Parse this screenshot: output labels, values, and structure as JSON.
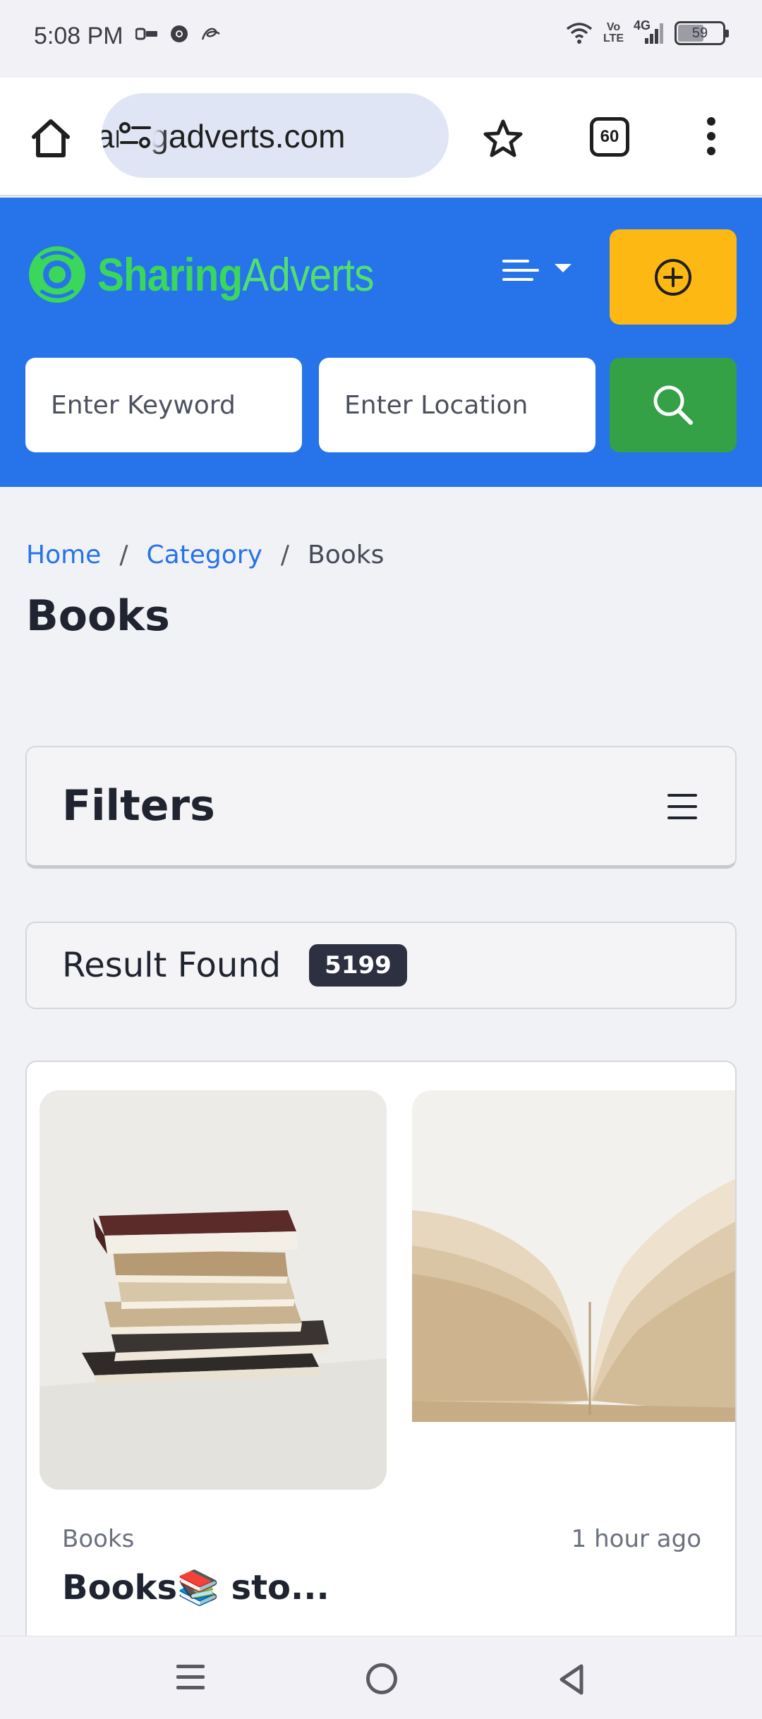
{
  "status_bar": {
    "time": "5:08 PM",
    "network_top": "Vo",
    "network_bottom": "LTE",
    "signal_label": "4G",
    "battery": "59",
    "icons": [
      "outlook-icon",
      "chrome-icon",
      "ink-icon",
      "wifi-icon",
      "signal-icon",
      "battery-icon"
    ]
  },
  "browser": {
    "url": "sharingadverts.com",
    "tab_count": "60",
    "icons": [
      "home-icon",
      "site-settings-icon",
      "bookmark-star-icon",
      "tabs-icon",
      "more-vert-icon"
    ]
  },
  "header": {
    "logo_bold": "Sharing",
    "logo_light": "Adverts",
    "keyword_placeholder": "Enter Keyword",
    "location_placeholder": "Enter Location",
    "colors": {
      "header_bg": "#2673ea",
      "post_button": "#fdb813",
      "search_button": "#35a146",
      "logo_green": "#3bd65c"
    }
  },
  "breadcrumb": {
    "home": "Home",
    "category": "Category",
    "separator": "/",
    "current": "Books"
  },
  "page": {
    "title": "Books"
  },
  "filters": {
    "title": "Filters"
  },
  "results": {
    "label": "Result Found",
    "count": "5199"
  },
  "listing": {
    "category": "Books",
    "time": "1 hour ago",
    "title": "Books📚 sto..."
  }
}
